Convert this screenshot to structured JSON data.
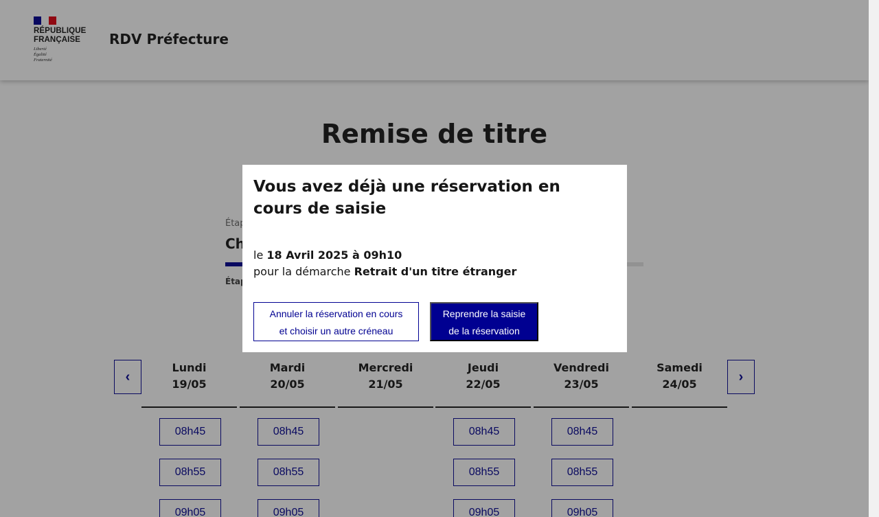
{
  "header": {
    "logo_line1": "RÉPUBLIQUE",
    "logo_line2": "FRANÇAISE",
    "devise1": "Liberté",
    "devise2": "Égalité",
    "devise3": "Fraternité",
    "site_title": "RDV Préfecture"
  },
  "main": {
    "page_title": "Remise de titre",
    "step_label": "Étap",
    "step_title": "Ch",
    "step_next": "Étap"
  },
  "calendar": {
    "days": [
      {
        "name": "Lundi",
        "date": "19/05",
        "slots": [
          "08h45",
          "08h55",
          "09h05"
        ]
      },
      {
        "name": "Mardi",
        "date": "20/05",
        "slots": [
          "08h45",
          "08h55",
          "09h05"
        ]
      },
      {
        "name": "Mercredi",
        "date": "21/05",
        "slots": []
      },
      {
        "name": "Jeudi",
        "date": "22/05",
        "slots": [
          "08h45",
          "08h55",
          "09h05"
        ]
      },
      {
        "name": "Vendredi",
        "date": "23/05",
        "slots": [
          "08h45",
          "08h55",
          "09h05"
        ]
      },
      {
        "name": "Samedi",
        "date": "24/05",
        "slots": []
      }
    ]
  },
  "modal": {
    "title": "Vous avez déjà une réservation en cours de saisie",
    "line1_prefix": "le ",
    "line1_value": "18 Avril 2025 à 09h10",
    "line2_prefix": "pour la démarche ",
    "line2_value": "Retrait d'un titre étranger",
    "cancel_line1": "Annuler la réservation en cours",
    "cancel_line2": "et choisir un autre créneau",
    "resume_line1": "Reprendre la saisie",
    "resume_line2": "de la réservation"
  },
  "colors": {
    "primary": "#000091",
    "text": "#161616",
    "flag_red": "#e1000f"
  }
}
